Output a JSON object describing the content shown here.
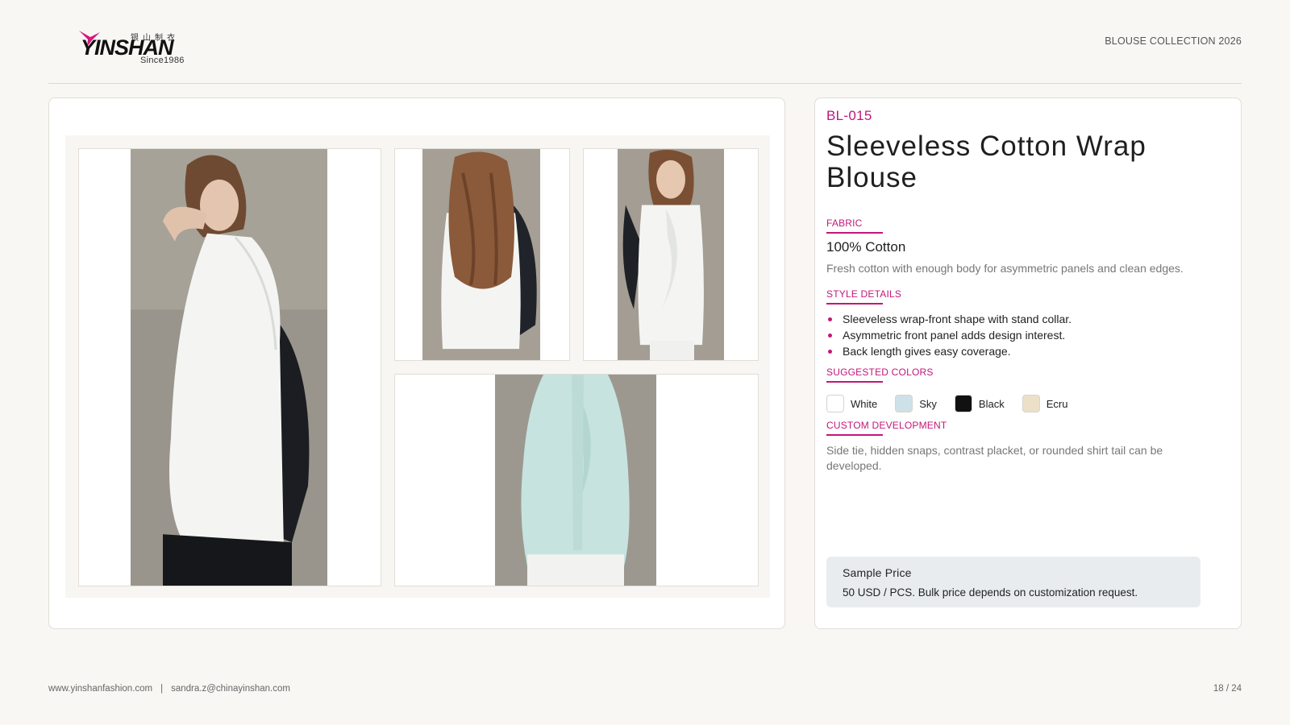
{
  "header": {
    "logo_cn": "银山制衣",
    "logo_word": "YINSHAN",
    "logo_since": "Since1986",
    "collection": "BLOUSE COLLECTION 2026",
    "accent_color": "#c2177a"
  },
  "gallery": {
    "photos": [
      {
        "icon": "model-side-view-photo",
        "garment_color": "#f4f5f3"
      },
      {
        "icon": "model-back-view-photo",
        "garment_color": "#f4f5f3"
      },
      {
        "icon": "model-front-view-photo",
        "garment_color": "#f4f5f3"
      },
      {
        "icon": "model-front-view-sky-photo",
        "garment_color": "#c7e3df"
      }
    ]
  },
  "product": {
    "code": "BL-015",
    "title": "Sleeveless Cotton Wrap Blouse",
    "fabric_label": "FABRIC",
    "fabric_value": "100% Cotton",
    "fabric_desc": "Fresh cotton with enough body for asymmetric panels and clean edges.",
    "style_label": "STYLE DETAILS",
    "style_details": [
      "Sleeveless wrap-front shape with stand collar.",
      "Asymmetric front panel adds design interest.",
      "Back length gives easy coverage."
    ],
    "colors_label": "SUGGESTED COLORS",
    "colors": [
      {
        "name": "White",
        "hex": "#ffffff"
      },
      {
        "name": "Sky",
        "hex": "#cfe1e8"
      },
      {
        "name": "Black",
        "hex": "#111111"
      },
      {
        "name": "Ecru",
        "hex": "#ece0c8"
      }
    ],
    "custom_label": "CUSTOM DEVELOPMENT",
    "custom_desc": "Side tie, hidden snaps, contrast placket, or rounded shirt tail can be developed.",
    "price_title": "Sample Price",
    "price_detail": "50 USD / PCS. Bulk price depends on customization request."
  },
  "footer": {
    "website": "www.yinshanfashion.com",
    "separator": "|",
    "email": "sandra.z@chinayinshan.com",
    "page": "18 / 24"
  }
}
